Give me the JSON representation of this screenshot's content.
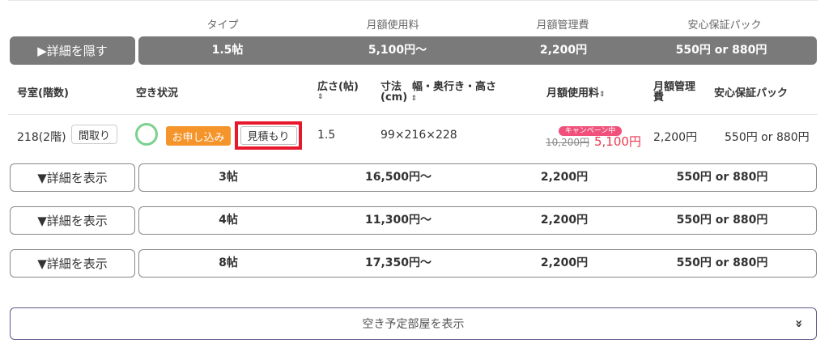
{
  "header": {
    "type": "タイプ",
    "monthly_fee": "月額使用料",
    "management_fee": "月額管理費",
    "security_pack": "安心保証パック"
  },
  "expanded": {
    "toggle_label": "▶詳細を隠す",
    "type": "1.5帖",
    "monthly_fee": "5,100円〜",
    "management_fee": "2,200円",
    "security_pack": "550円 or 880円"
  },
  "table": {
    "headers": {
      "room": "号室(階数)",
      "availability": "空き状況",
      "area_line1": "広さ(帖)",
      "sort_symbol": "⇕",
      "dims_line1": "寸法　幅・奥行き・高さ",
      "dims_line2": "(cm)",
      "fee": "月額使用料",
      "mgmt_line1": "月額管理",
      "mgmt_line2": "費",
      "pack": "安心保証パック"
    },
    "row": {
      "room": "218(2階)",
      "floorplan_label": "間取り",
      "apply_label": "お申し込み",
      "estimate_label": "見積もり",
      "area": "1.5",
      "dims": "99×216×228",
      "campaign_label": "キャンペーン中",
      "old_price": "10,200円",
      "new_price": "5,100円",
      "mgmt": "2,200円",
      "pack": "550円 or 880円"
    }
  },
  "collapsed_rows": [
    {
      "toggle_label": "▼詳細を表示",
      "type": "3帖",
      "monthly_fee": "16,500円〜",
      "management_fee": "2,200円",
      "security_pack": "550円 or 880円"
    },
    {
      "toggle_label": "▼詳細を表示",
      "type": "4帖",
      "monthly_fee": "11,300円〜",
      "management_fee": "2,200円",
      "security_pack": "550円 or 880円"
    },
    {
      "toggle_label": "▼詳細を表示",
      "type": "8帖",
      "monthly_fee": "17,350円〜",
      "management_fee": "2,200円",
      "security_pack": "550円 or 880円"
    }
  ],
  "bottom": {
    "label": "空き予定部屋を表示",
    "chevron": "»"
  },
  "colors": {
    "gray_bar": "#7a7a7a",
    "apply_orange": "#f4942a",
    "highlight_red": "#e8182c",
    "available_green": "#7bd18e",
    "campaign_pink": "#f0507a"
  }
}
